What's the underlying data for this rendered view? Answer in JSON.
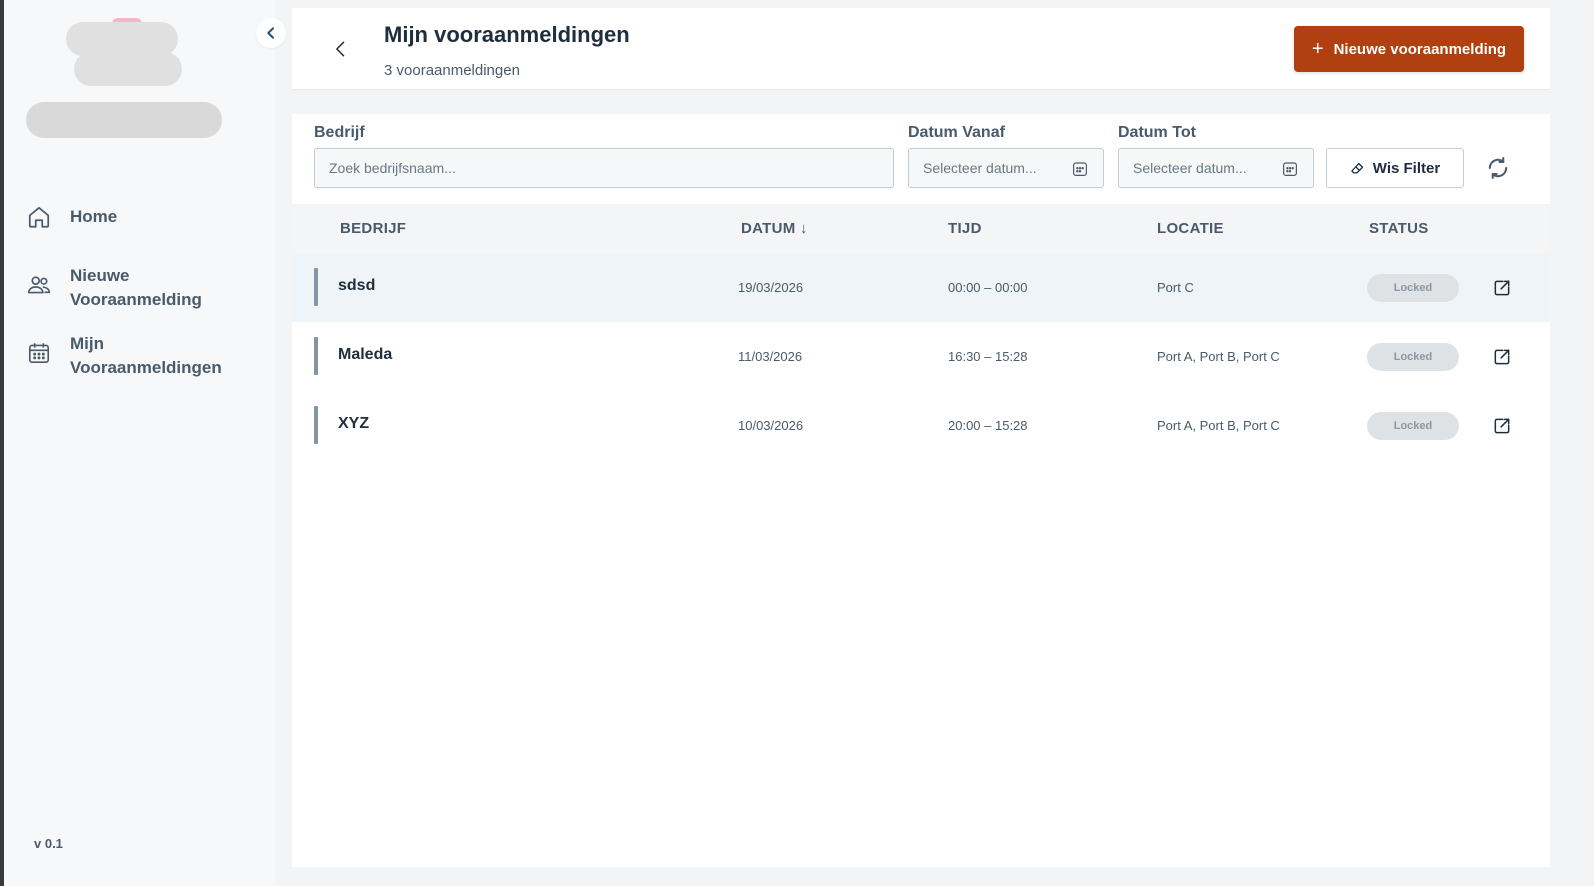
{
  "sidebar": {
    "version": "v 0.1",
    "items": [
      {
        "label": "Home",
        "icon": "home-icon"
      },
      {
        "label": "Nieuwe Vooraanmelding",
        "icon": "users-icon"
      },
      {
        "label": "Mijn Vooraanmeldingen",
        "icon": "calendar-icon"
      }
    ]
  },
  "header": {
    "title": "Mijn vooraanmeldingen",
    "subtitle": "3 vooraanmeldingen",
    "new_button": "Nieuwe vooraanmelding",
    "accent_color": "#b0400f"
  },
  "filters": {
    "company_label": "Bedrijf",
    "company_placeholder": "Zoek bedrijfsnaam...",
    "date_from_label": "Datum Vanaf",
    "date_from_placeholder": "Selecteer datum...",
    "date_to_label": "Datum Tot",
    "date_to_placeholder": "Selecteer datum...",
    "clear_button": "Wis Filter"
  },
  "table": {
    "columns": [
      "BEDRIJF",
      "DATUM ↓",
      "TIJD",
      "LOCATIE",
      "STATUS"
    ],
    "rows": [
      {
        "company": "sdsd",
        "date": "19/03/2026",
        "time": "00:00 – 00:00",
        "location": "Port C",
        "status": "Locked"
      },
      {
        "company": "Maleda",
        "date": "11/03/2026",
        "time": "16:30 – 15:28",
        "location": "Port A, Port B, Port C",
        "status": "Locked"
      },
      {
        "company": "XYZ",
        "date": "10/03/2026",
        "time": "20:00 – 15:28",
        "location": "Port A, Port B, Port C",
        "status": "Locked"
      }
    ]
  }
}
